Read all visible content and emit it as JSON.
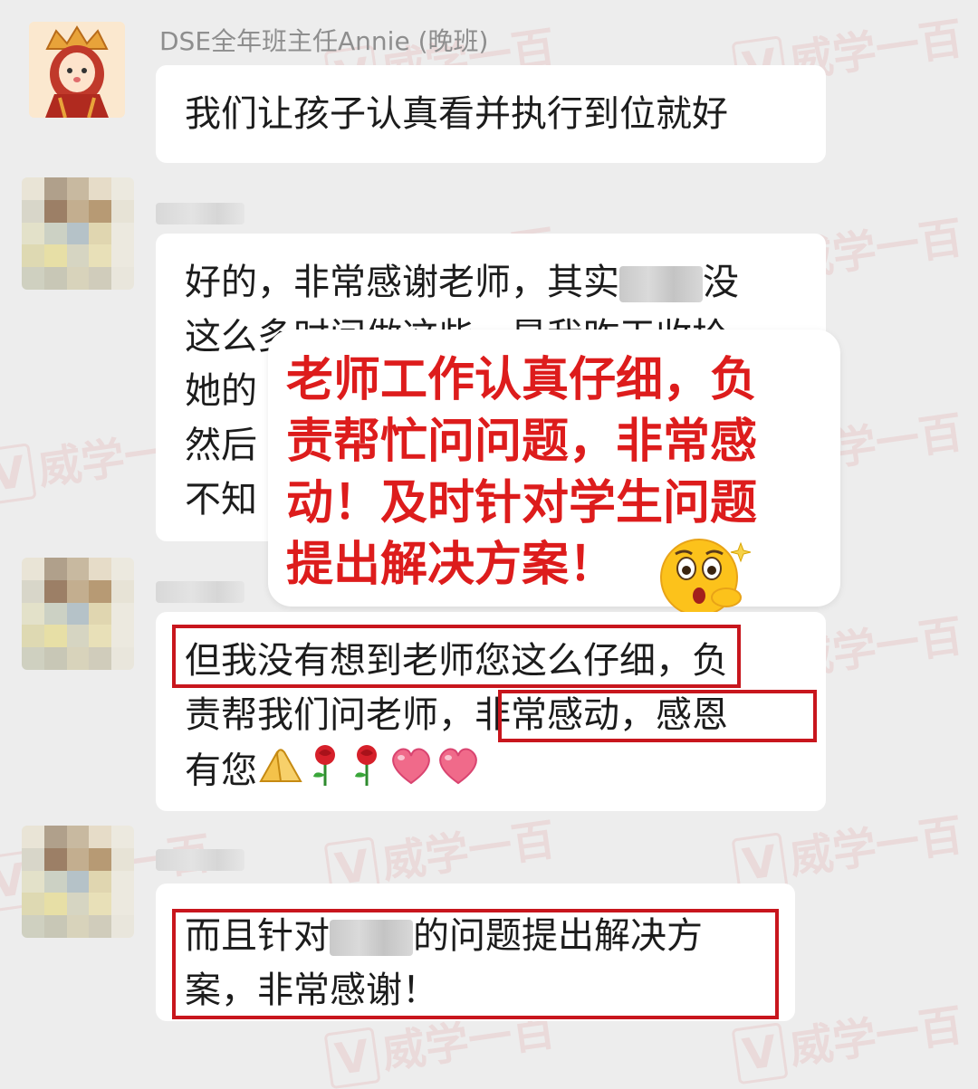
{
  "messages": [
    {
      "sender": "DSE全年班主任Annie (晚班)",
      "lines": [
        "我们让孩子认真看并执行到位就好"
      ]
    },
    {
      "sender": "",
      "lines": [
        {
          "before": "好的，非常感谢老师，其实",
          "after": "没"
        },
        "这么多时间做这些，是我昨天收拾",
        "她的",
        "然后",
        "不知"
      ]
    },
    {
      "sender": "",
      "lines": [
        "但我没有想到老师您这么仔细，负",
        "责帮我们问老师，非常感动，感恩",
        "有您"
      ]
    },
    {
      "sender": "",
      "lines": [
        {
          "before": "而且针对",
          "after": "的问题提出解决方"
        },
        "案，非常感谢！"
      ]
    }
  ],
  "callout": {
    "lines": [
      "老师工作认真仔细，负",
      "责帮忙问问题，非常感",
      "动！及时针对学生问题",
      "提出解决方案！"
    ]
  },
  "watermark": {
    "text": "威学一百"
  },
  "icons": {
    "praying-hands": "🙏",
    "rose": "🌹",
    "heart": "❤",
    "astonished-face": "😲"
  },
  "colors": {
    "accent": "#c8161d",
    "callout_text": "#dd1c1c",
    "background": "#ededed"
  }
}
